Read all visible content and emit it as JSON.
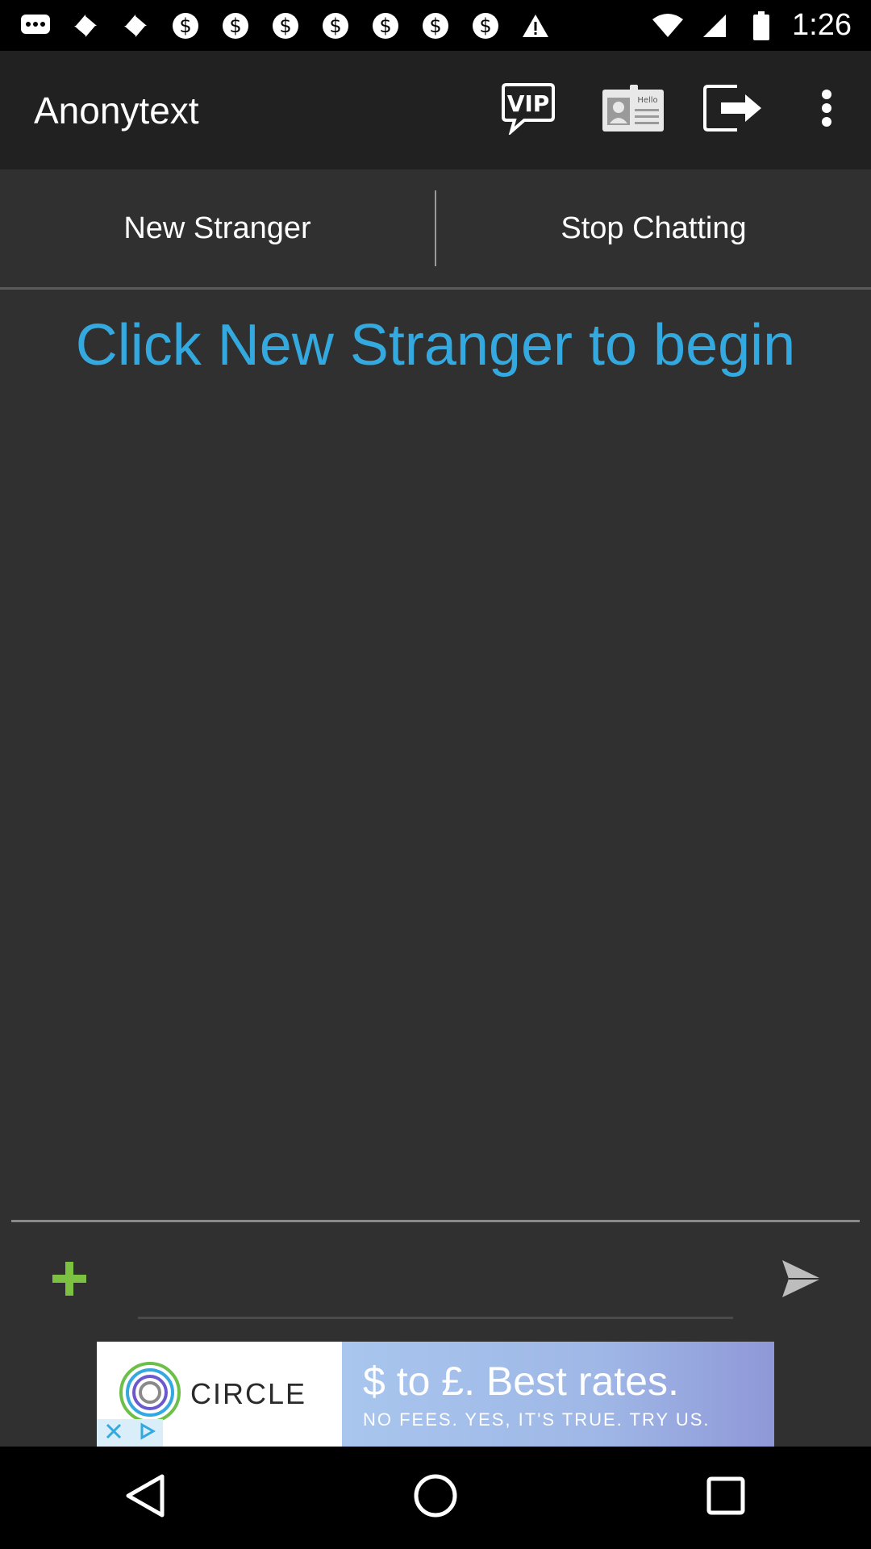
{
  "status_bar": {
    "time": "1:26",
    "notification_icons": [
      "messages-icon",
      "pinwheel-icon",
      "pinwheel-icon",
      "dollar-icon",
      "dollar-icon",
      "dollar-icon",
      "dollar-icon",
      "dollar-icon",
      "dollar-icon",
      "dollar-icon",
      "warning-icon"
    ]
  },
  "app_bar": {
    "title": "Anonytext",
    "actions": [
      {
        "name": "vip-icon",
        "label": "VIP"
      },
      {
        "name": "hello-card-icon",
        "label": "Hello"
      },
      {
        "name": "logout-icon"
      },
      {
        "name": "overflow-menu-icon"
      }
    ]
  },
  "tabs": {
    "new_stranger": "New Stranger",
    "stop_chatting": "Stop Chatting"
  },
  "message_area": {
    "hint": "Click New Stranger to begin"
  },
  "composer": {
    "input_value": "",
    "input_placeholder": "",
    "add_icon": "plus-icon",
    "send_icon": "send-icon"
  },
  "ad": {
    "brand": "CIRCLE",
    "headline": "$ to £. Best rates.",
    "subline": "NO FEES. YES, IT'S TRUE. TRY US."
  },
  "colors": {
    "background": "#303030",
    "app_bar": "#212121",
    "hint_text": "#33a9e0",
    "plus_icon": "#7cc142"
  }
}
